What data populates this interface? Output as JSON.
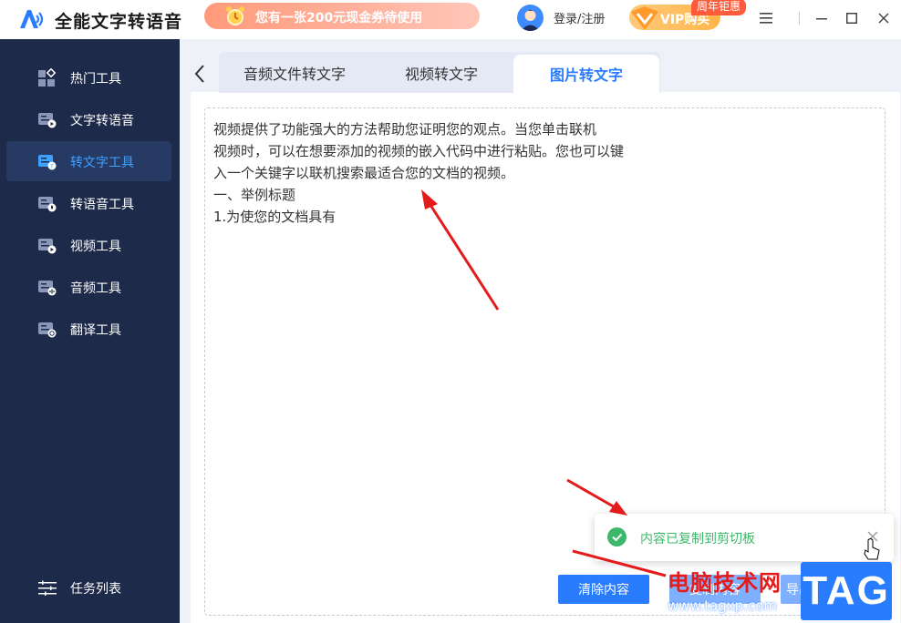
{
  "app": {
    "title": "全能文字转语音",
    "promo": "您有一张200元现金券待使用",
    "login": "登录/注册",
    "vip": "VIP购买",
    "vip_badge": "周年钜惠"
  },
  "sidebar": {
    "items": [
      {
        "label": "热门工具",
        "icon": "hot-tools-icon"
      },
      {
        "label": "文字转语音",
        "icon": "text-to-speech-icon"
      },
      {
        "label": "转文字工具",
        "icon": "to-text-tools-icon",
        "active": true
      },
      {
        "label": "转语音工具",
        "icon": "to-speech-tools-icon"
      },
      {
        "label": "视频工具",
        "icon": "video-tools-icon"
      },
      {
        "label": "音频工具",
        "icon": "audio-tools-icon"
      },
      {
        "label": "翻译工具",
        "icon": "translate-tools-icon"
      }
    ],
    "task_list": "任务列表"
  },
  "tabs": [
    {
      "label": "音频文件转文字"
    },
    {
      "label": "视频转文字"
    },
    {
      "label": "图片转文字",
      "active": true
    }
  ],
  "editor": {
    "lines": [
      "视频提供了功能强大的方法帮助您证明您的观点。当您单击联机",
      "视频时，可以在想要添加的视频的嵌入代码中进行粘贴。您也可以键",
      "入一个关键字以联机搜索最适合您的文档的视频。",
      "一、举例标题",
      "1.为使您的文档具有"
    ]
  },
  "buttons": {
    "clear": "清除内容",
    "copy": "复制内容",
    "export": "导出"
  },
  "toast": {
    "message": "内容已复制到剪切板"
  },
  "watermark": {
    "site": "电脑技术网",
    "url": "www.tagxp.com",
    "tag": "TAG"
  },
  "colors": {
    "accent": "#2a7cff",
    "sidebar": "#1d2a4a",
    "success": "#3db86b",
    "annotation": "#e41b1b"
  }
}
